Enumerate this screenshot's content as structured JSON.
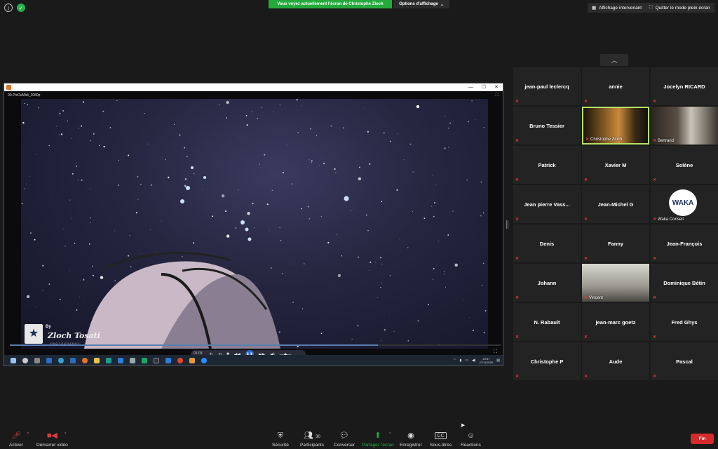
{
  "top": {
    "banner": "Vous voyez actuellement l'écran de Christophe Zloch",
    "view_options": "Options d'affichage",
    "speaker_view": "Affichage intervenant",
    "fullscreen": "Quitter le mode plein écran"
  },
  "shared": {
    "video_file": "00-PicDuMidi_1080p",
    "time": "01:03",
    "progress": 0.75,
    "logo_by": "By",
    "logo_name": "Zloch Tosati",
    "logo_sub": "PHOTOGRAPHY",
    "clock_time": "20:57",
    "clock_date": "27/11/2020"
  },
  "gallery": {
    "tiles": [
      {
        "name": "jean-paul leclercq",
        "video": false
      },
      {
        "name": "annie",
        "video": false
      },
      {
        "name": "Jocelyn RICARD",
        "video": false
      },
      {
        "name": "Bruno Tessier",
        "video": false
      },
      {
        "name": "Christophe Zloch",
        "video": true,
        "active": true
      },
      {
        "name": "Bertrand",
        "video": true
      },
      {
        "name": "Patrick",
        "video": false
      },
      {
        "name": "Xavier M",
        "video": false
      },
      {
        "name": "Solène",
        "video": false
      },
      {
        "name": "Jean pierre Vass...",
        "video": false
      },
      {
        "name": "Jean-Michel G",
        "video": false
      },
      {
        "name": "Waka Conseil",
        "video": true,
        "logo": "WAKA"
      },
      {
        "name": "Denis",
        "video": false
      },
      {
        "name": "Fanny",
        "video": false
      },
      {
        "name": "Jean-François",
        "video": false
      },
      {
        "name": "Johann",
        "video": false
      },
      {
        "name": "Vincent",
        "video": true
      },
      {
        "name": "Dominique Bétin",
        "video": false
      },
      {
        "name": "N. Rabault",
        "video": false
      },
      {
        "name": "jean-marc goetz",
        "video": false
      },
      {
        "name": "Fred Ghys",
        "video": false
      },
      {
        "name": "Christophe P",
        "video": false
      },
      {
        "name": "Aude",
        "video": false
      },
      {
        "name": "Pascal",
        "video": false
      }
    ]
  },
  "bottom": {
    "mute": "Activer",
    "video": "Démarrer vidéo",
    "security": "Sécurité",
    "participants": "Participants",
    "participants_count": "30",
    "chat": "Converser",
    "share": "Partager l'écran",
    "record": "Enregistrer",
    "captions": "Sous-titres",
    "cc": "CC",
    "reactions": "Réactions",
    "end": "Fin"
  },
  "colors": {
    "banner_green": "#24a93b",
    "active_border": "#b8e068",
    "end_red": "#d62b2b",
    "share_green": "#1fb141"
  }
}
